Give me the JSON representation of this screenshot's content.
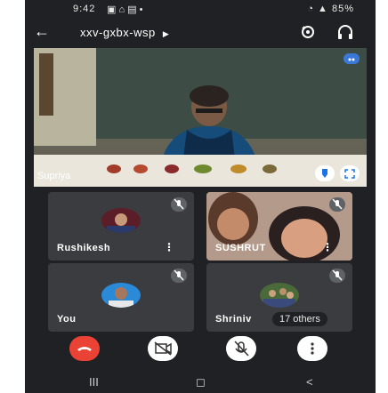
{
  "status_bar": {
    "time": "9:42",
    "right_text": "85%"
  },
  "appbar": {
    "meeting_code": "xxv-gxbx-wsp",
    "icons": [
      "back-arrow-icon",
      "chevron-right-icon",
      "switch-camera-icon",
      "headphones-icon"
    ]
  },
  "main_video": {
    "participant": "Supriya"
  },
  "tiles": [
    {
      "name": "Rushikesh",
      "muted": true
    },
    {
      "name": "SUSHRUT",
      "muted": true
    },
    {
      "name": "You",
      "muted": true
    },
    {
      "name": "Shriniv",
      "muted": true,
      "others_badge": "17 others"
    }
  ],
  "controls": [
    "end-call-icon",
    "camera-off-icon",
    "mic-off-icon",
    "more-vert-icon"
  ],
  "navbar": {
    "recent": "III",
    "home": "◻",
    "back": "<"
  },
  "colors": {
    "background": "#202124",
    "tile": "#3a3c40",
    "end_call": "#ea4335"
  }
}
